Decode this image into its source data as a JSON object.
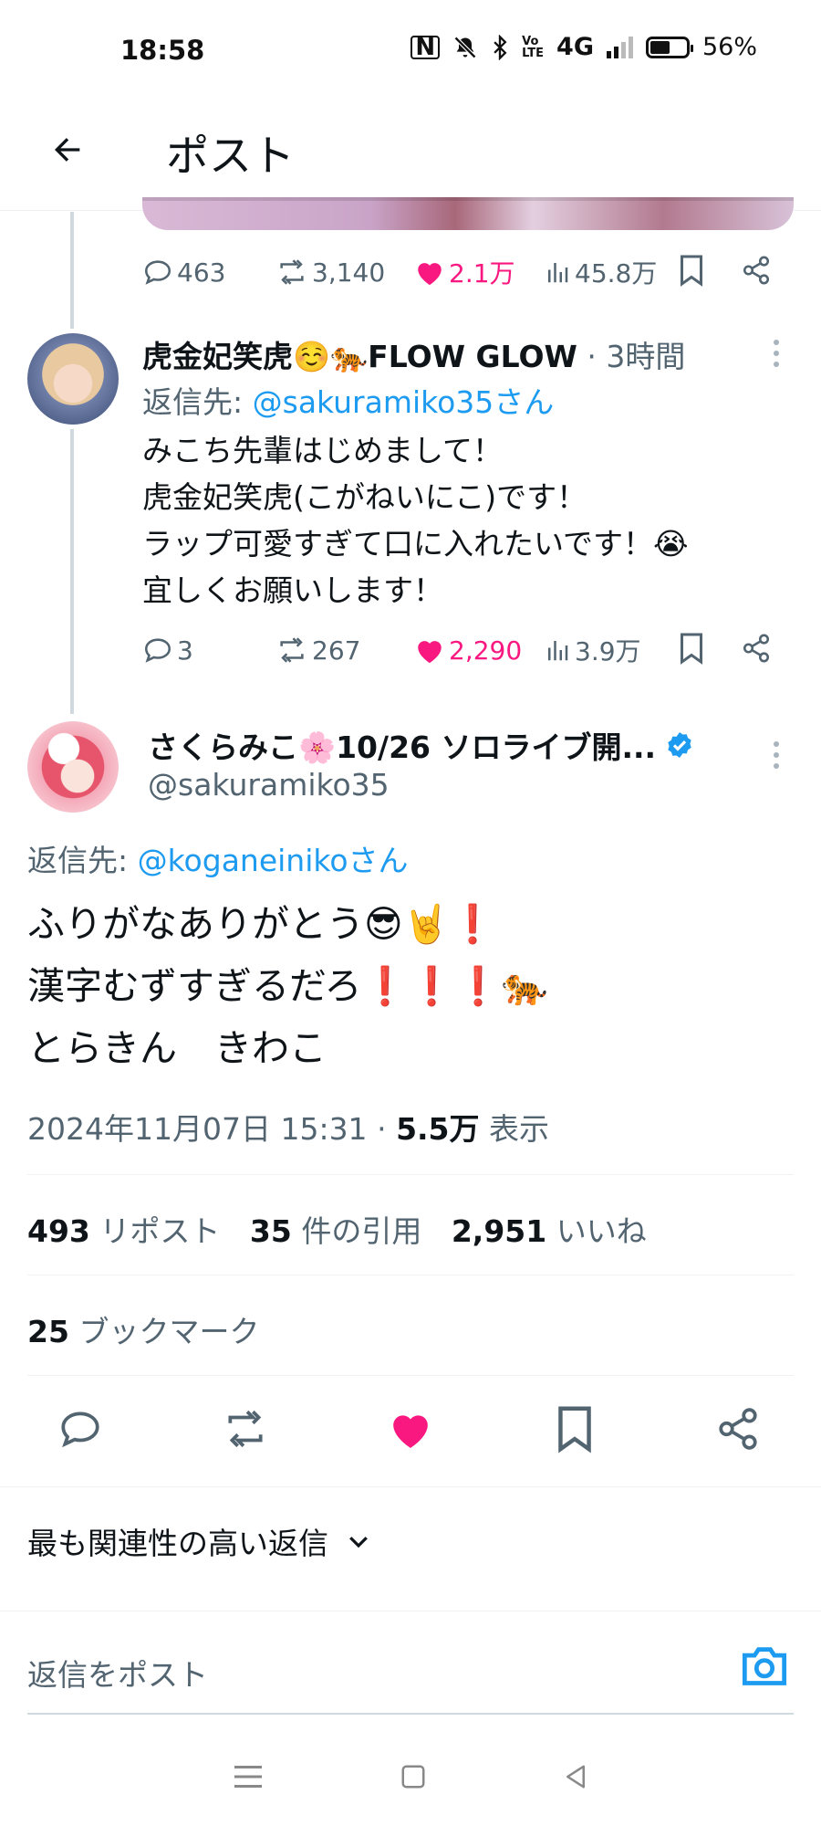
{
  "status_bar": {
    "time": "18:58",
    "network": "4G",
    "battery_percent": "56%",
    "battery_level": 0.56
  },
  "header": {
    "title": "ポスト"
  },
  "prev_tweet_actions": {
    "replies": "463",
    "reposts": "3,140",
    "likes": "2.1万",
    "views": "45.8万"
  },
  "reply_tweet": {
    "display_name": "虎金妃笑虎☺️🐅FLOW GLOW",
    "time_sep": "·",
    "time": "3時間",
    "reply_to_prefix": "返信先:",
    "reply_to_handle": "@sakuramiko35さん",
    "lines": [
      "みこち先輩はじめまして！",
      "虎金妃笑虎(こがねいにこ)です！",
      "ラップ可愛すぎて口に入れたいです！😭",
      "宜しくお願いします！"
    ],
    "replies": "3",
    "reposts": "267",
    "likes": "2,290",
    "views": "3.9万"
  },
  "main_tweet": {
    "display_name": "さくらみこ🌸10/26 ソロライブ開...",
    "handle": "@sakuramiko35",
    "reply_to_prefix": "返信先:",
    "reply_to_handle": "@koganeinikoさん",
    "lines": [
      "ふりがなありがとう😎🤘❗",
      "漢字むずすぎるだろ❗❗❗🐅",
      "とらきん　きわこ"
    ],
    "timestamp": "2024年11月07日 15:31",
    "dot": "·",
    "views": "5.5万",
    "views_label": "表示",
    "reposts_count": "493",
    "reposts_label": "リポスト",
    "quotes_count": "35",
    "quotes_label": "件の引用",
    "likes_count": "2,951",
    "likes_label": "いいね",
    "bookmarks_count": "25",
    "bookmarks_label": "ブックマーク"
  },
  "replies_section": {
    "sort_label": "最も関連性の高い返信"
  },
  "composer": {
    "placeholder": "返信をポスト"
  },
  "colors": {
    "like": "#f91880",
    "link": "#1d9bf0",
    "muted": "#536471",
    "verified": "#1d9bf0"
  }
}
